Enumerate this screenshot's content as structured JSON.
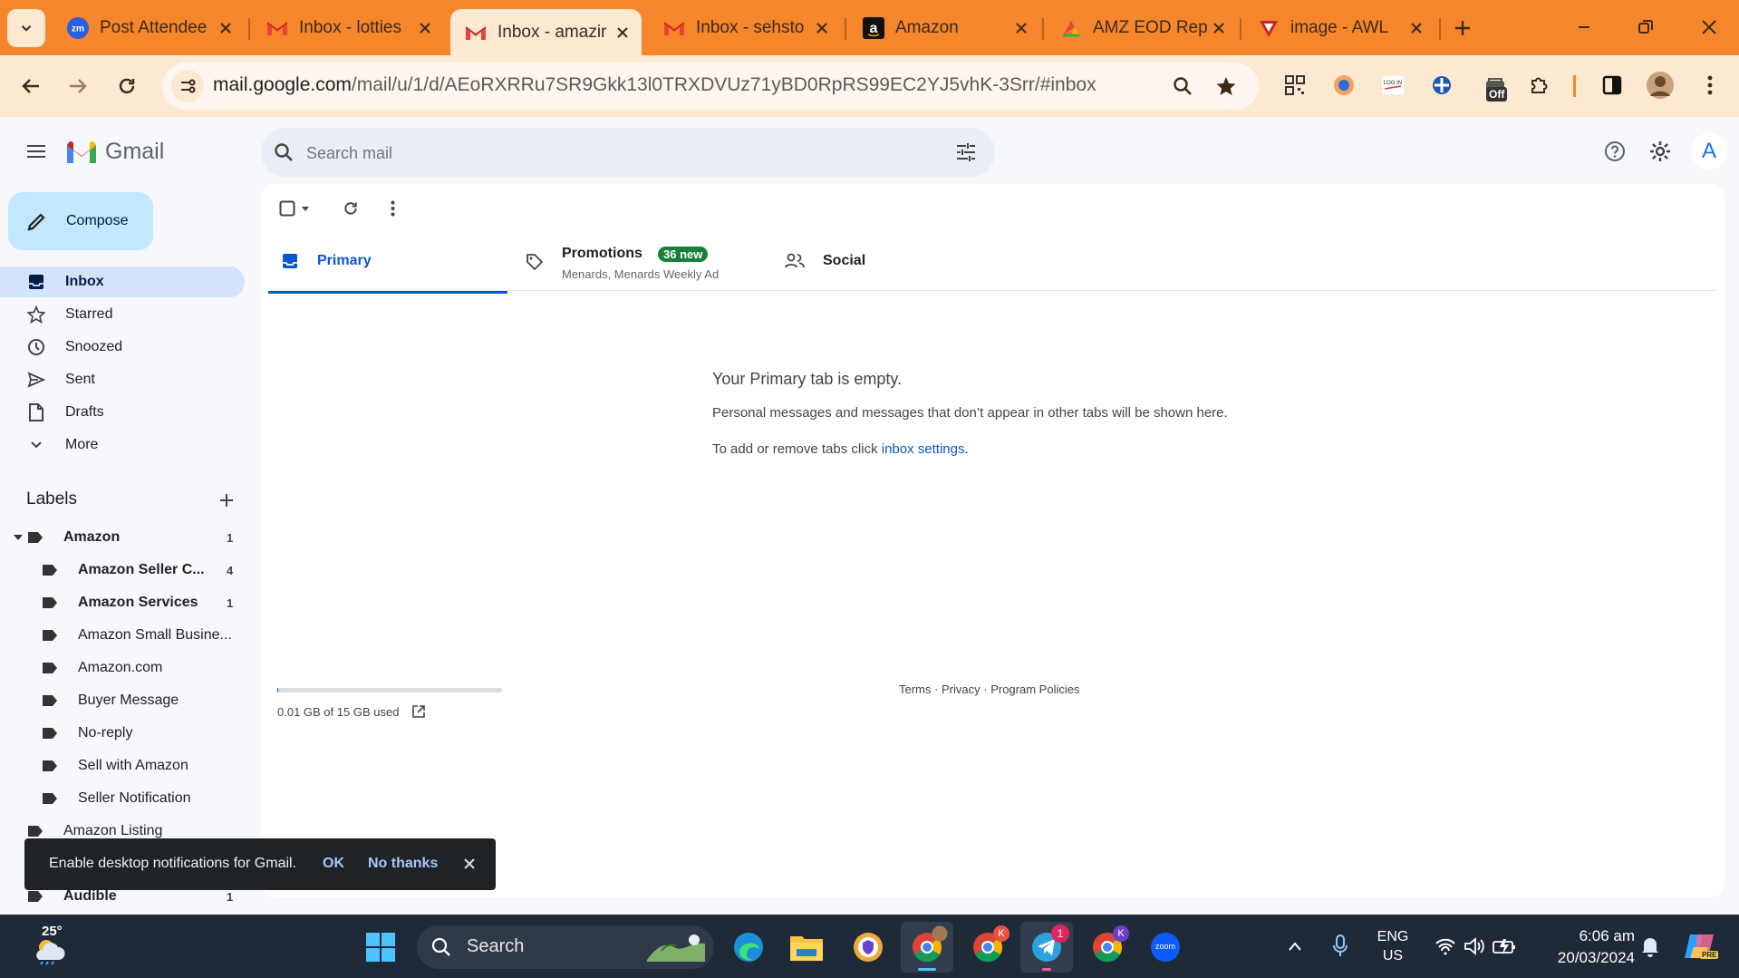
{
  "browser": {
    "tabs": [
      {
        "title": "Post Attendee",
        "favicon": "zoom-icon",
        "active": false
      },
      {
        "title": "Inbox - lotties",
        "favicon": "gmail-icon",
        "active": false
      },
      {
        "title": "Inbox - amazir",
        "favicon": "gmail-icon",
        "active": true
      },
      {
        "title": "Inbox - sehsto",
        "favicon": "gmail-icon",
        "active": false
      },
      {
        "title": "Amazon",
        "favicon": "amazon-icon",
        "active": false
      },
      {
        "title": "AMZ EOD Rep",
        "favicon": "amz-eod-icon",
        "active": false
      },
      {
        "title": "image - AWL",
        "favicon": "awl-icon",
        "active": false
      }
    ],
    "url_host": "mail.google.com",
    "url_path": "/mail/u/1/d/AEoRXRRu7SR9Gkk13l0TRXDVUz71yBD0RpRS99EC2YJ5vhK-3Srr/#inbox",
    "extension_badge": "Off"
  },
  "gmail": {
    "logo_text": "Gmail",
    "search_placeholder": "Search mail",
    "account_initial": "A",
    "compose_label": "Compose",
    "nav": [
      {
        "label": "Inbox",
        "icon": "inbox-icon"
      },
      {
        "label": "Starred",
        "icon": "star-icon"
      },
      {
        "label": "Snoozed",
        "icon": "clock-icon"
      },
      {
        "label": "Sent",
        "icon": "send-icon"
      },
      {
        "label": "Drafts",
        "icon": "draft-icon"
      },
      {
        "label": "More",
        "icon": "chevron-down-icon"
      }
    ],
    "labels_heading": "Labels",
    "labels": [
      {
        "name": "Amazon",
        "count": "1",
        "bold": true
      },
      {
        "name": "Amazon Seller C...",
        "count": "4",
        "bold": true
      },
      {
        "name": "Amazon Services",
        "count": "1",
        "bold": true
      },
      {
        "name": "Amazon Small Busine...",
        "count": "",
        "bold": false
      },
      {
        "name": "Amazon.com",
        "count": "",
        "bold": false
      },
      {
        "name": "Buyer Message",
        "count": "",
        "bold": false
      },
      {
        "name": "No-reply",
        "count": "",
        "bold": false
      },
      {
        "name": "Sell with Amazon",
        "count": "",
        "bold": false
      },
      {
        "name": "Seller Notification",
        "count": "",
        "bold": false
      },
      {
        "name": "Amazon Listing",
        "count": "",
        "bold": false
      },
      {
        "name": "Audible",
        "count": "1",
        "bold": true
      }
    ],
    "tabs": {
      "primary": "Primary",
      "promotions": "Promotions",
      "promotions_badge": "36 new",
      "promotions_sub": "Menards, Menards Weekly Ad",
      "social": "Social"
    },
    "empty": {
      "title": "Your Primary tab is empty.",
      "line1": "Personal messages and messages that don’t appear in other tabs will be shown here.",
      "line2_prefix": "To add or remove tabs click ",
      "line2_link": "inbox settings",
      "line2_suffix": "."
    },
    "storage": {
      "text": "0.01 GB of 15 GB used",
      "used_fraction": 0.001
    },
    "footer": {
      "terms": "Terms",
      "privacy": "Privacy",
      "policies": "Program Policies",
      "sep": "·"
    },
    "snackbar": {
      "text": "Enable desktop notifications for Gmail.",
      "ok": "OK",
      "no": "No thanks"
    }
  },
  "taskbar": {
    "weather_temp": "25°",
    "search_label": "Search",
    "language_top": "ENG",
    "language_bottom": "US",
    "time": "6:06 am",
    "date": "20/03/2024",
    "telegram_badge": "1",
    "chrome_profile_a": "K",
    "chrome_profile_b": "K",
    "zoom_label": "zoom",
    "copilot_badge": "PRE"
  },
  "colors": {
    "tabstrip": "#f5862b",
    "toolbar": "#fde8d2",
    "gmail_blue": "#0b57d0",
    "badge_green": "#188038"
  }
}
